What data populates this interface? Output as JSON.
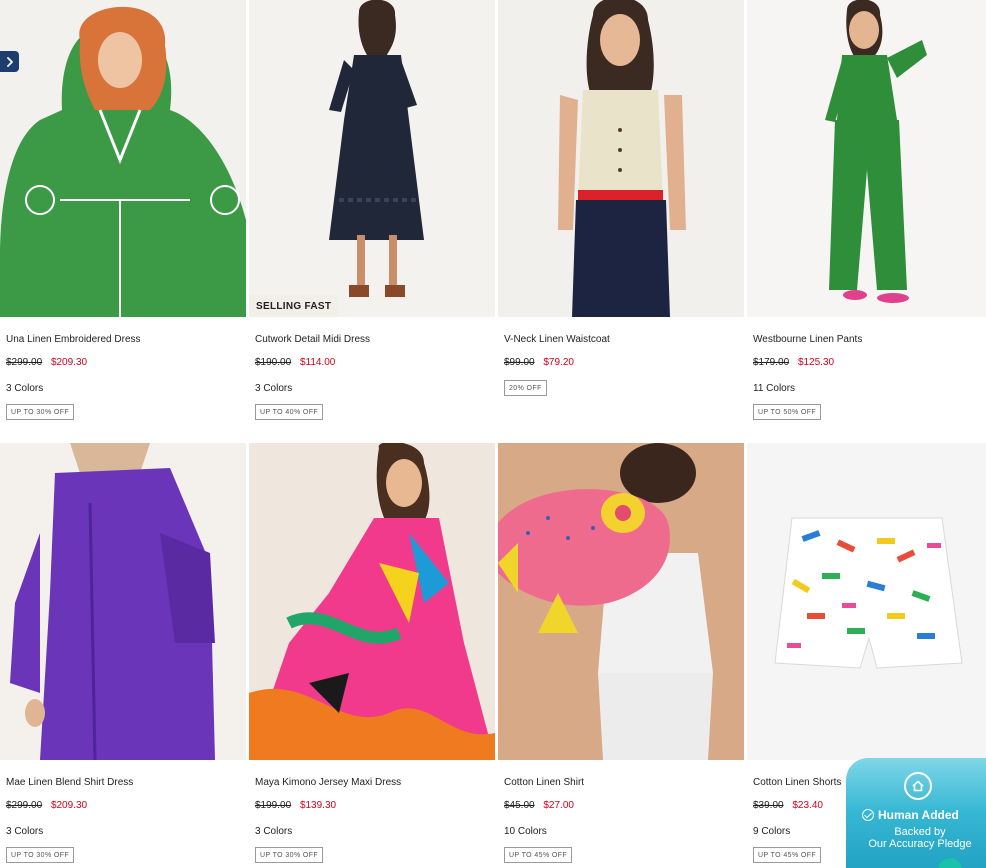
{
  "products": [
    {
      "name": "Una Linen Embroidered Dress",
      "was": "$299.00",
      "now": "$209.30",
      "colors": "3 Colors",
      "off": "UP TO 30% OFF"
    },
    {
      "name": "Cutwork Detail Midi Dress",
      "was": "$190.00",
      "now": "$114.00",
      "colors": "3 Colors",
      "off": "UP TO 40% OFF",
      "badge": "SELLING FAST"
    },
    {
      "name": "V-Neck Linen Waistcoat",
      "was": "$99.00",
      "now": "$79.20",
      "colors": "",
      "off": "20% OFF"
    },
    {
      "name": "Westbourne Linen Pants",
      "was": "$179.00",
      "now": "$125.30",
      "colors": "11 Colors",
      "off": "UP TO 50% OFF"
    },
    {
      "name": "Mae Linen Blend Shirt Dress",
      "was": "$299.00",
      "now": "$209.30",
      "colors": "3 Colors",
      "off": "UP TO 30% OFF"
    },
    {
      "name": "Maya Kimono Jersey Maxi Dress",
      "was": "$199.00",
      "now": "$139.30",
      "colors": "3 Colors",
      "off": "UP TO 30% OFF"
    },
    {
      "name": "Cotton Linen Shirt",
      "was": "$45.00",
      "now": "$27.00",
      "colors": "10 Colors",
      "off": "UP TO 45% OFF"
    },
    {
      "name": "Cotton Linen Shorts",
      "was": "$39.00",
      "now": "$23.40",
      "colors": "9 Colors",
      "off": "UP TO 45% OFF"
    }
  ],
  "pledge": {
    "title": "Human Added",
    "line1": "Backed by",
    "line2": "Our Accuracy Pledge"
  },
  "icons": {
    "carousel_arrow": "chevron-right-icon",
    "pledge_home": "house-icon",
    "pledge_check": "check-circle-icon"
  },
  "colors": {
    "sale_price": "#d0021b",
    "arrow_bg": "#1f3c6e",
    "pledge_bg": "#36b7d3"
  }
}
